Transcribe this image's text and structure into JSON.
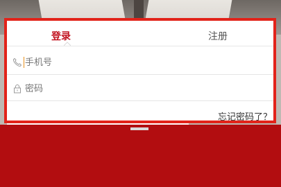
{
  "tabs": [
    {
      "label": "登录",
      "active": true
    },
    {
      "label": "注册",
      "active": false
    }
  ],
  "form": {
    "phone_placeholder": "手机号",
    "password_placeholder": "密码"
  },
  "links": {
    "forgot_password": "忘记密码了？"
  },
  "icons": {
    "phone": "phone-icon",
    "lock": "lock-icon",
    "tab_indicator": "caret-up-icon"
  },
  "colors": {
    "highlight_border": "#e2231a",
    "brand_red": "#c1121f",
    "bottom_bar": "#b20d10",
    "caret": "#e8901b"
  }
}
